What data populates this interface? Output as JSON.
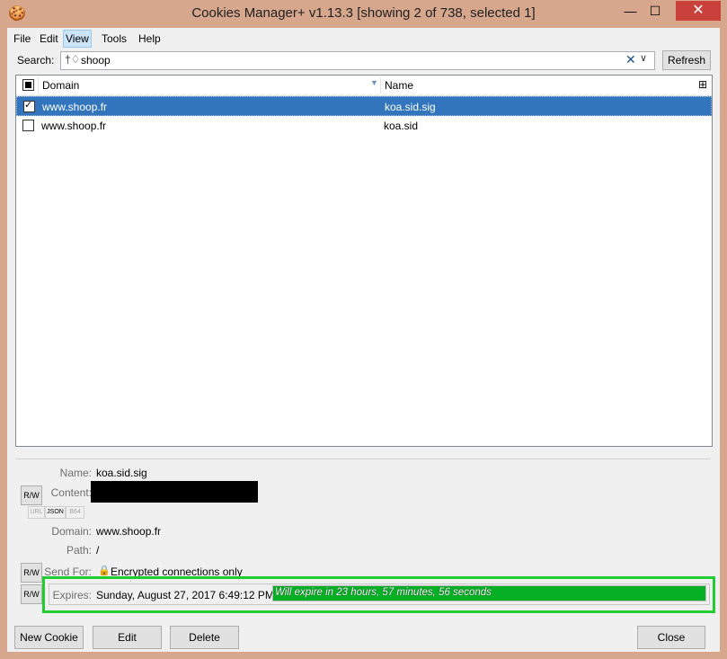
{
  "window": {
    "title": "Cookies Manager+ v1.13.3 [showing 2 of 738, selected 1]",
    "controls": {
      "minimize": "—",
      "maximize": "☐",
      "close": "✕"
    }
  },
  "menu": [
    {
      "label": "File"
    },
    {
      "label": "Edit"
    },
    {
      "label": "View"
    },
    {
      "label": "Tools"
    },
    {
      "label": "Help"
    }
  ],
  "search": {
    "label": "Search:",
    "value": "shoop",
    "icon": "filter-icon",
    "clear_glyph": "✕",
    "dropdown_glyph": "∨",
    "refresh_label": "Refresh"
  },
  "list": {
    "columns": [
      {
        "label": "Domain"
      },
      {
        "label": "Name"
      }
    ],
    "rows": [
      {
        "domain": "www.shoop.fr",
        "name": "koa.sid.sig",
        "selected": true,
        "checked": true
      },
      {
        "domain": "www.shoop.fr",
        "name": "koa.sid",
        "selected": false,
        "checked": false
      }
    ]
  },
  "details": {
    "name_label": "Name:",
    "name_value": "koa.sid.sig",
    "content_label": "Content:",
    "domain_label": "Domain:",
    "domain_value": "www.shoop.fr",
    "path_label": "Path:",
    "path_value": "/",
    "send_for_label": "Send For:",
    "send_for_value": "Encrypted connections only",
    "expires_label": "Expires:",
    "expires_value": "Sunday, August 27, 2017 6:49:12 PM",
    "expires_countdown": "Will expire in 23 hours, 57 minutes, 56 seconds",
    "expires_progress": 1.0,
    "rw_label": "R/W",
    "format_buttons": [
      "URL",
      "JSON",
      "B64"
    ]
  },
  "buttons": {
    "new_cookie": "New Cookie",
    "edit": "Edit",
    "delete": "Delete",
    "close": "Close"
  },
  "colors": {
    "selection": "#3275bd",
    "highlight_frame": "#22cc33",
    "progress_fill": "#06b025",
    "titlebar": "#d6a78c",
    "close_button": "#c9413a"
  }
}
